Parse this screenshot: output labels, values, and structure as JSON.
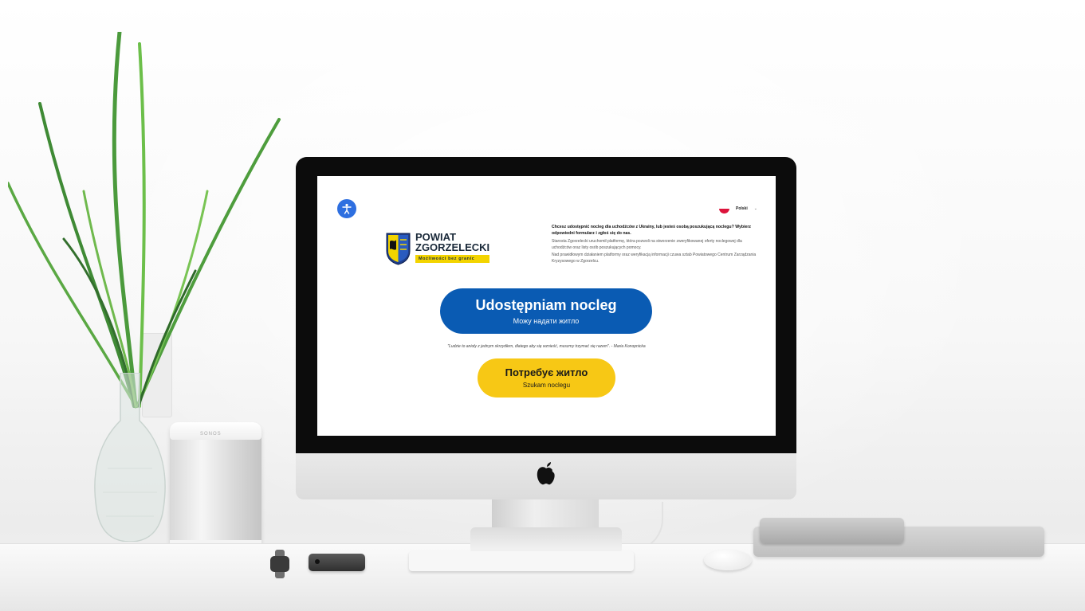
{
  "screen": {
    "accessibility": {
      "icon": "accessibility-person-icon",
      "color": "#2e6fe0"
    },
    "language": {
      "label": "Polski",
      "flag": "poland-flag-icon",
      "chevron": "chevron-down-icon"
    },
    "logo": {
      "line1": "POWIAT",
      "line2": "ZGORZELECKI",
      "tagline": "Możliwości bez granic",
      "crest": "coat-of-arms-crest-icon"
    },
    "intro": {
      "lead": "Chcesz udostępnić nocleg dla uchodźców z Ukrainy, lub jesteś osobą poszukującą noclegu? Wybierz odpowiedni formularz i zgłoś się do nas.",
      "p1": "Starosta Zgorzelecki uruchomił platformę, która pozwoli na stworzenie zweryfikowanej oferty noclegowej dla uchodźców oraz listy osób poszukujących pomocy.",
      "p2": "Nad prawidłowym działaniem platformy oraz weryfikacją informacji czuwa sztab Powiatowego Centrum Zarządzania Kryzysowego w Zgorzelcu."
    },
    "offer_button": {
      "title": "Udostępniam nocleg",
      "subtitle": "Можу надати житло",
      "color": "#0a5bb3"
    },
    "quote": "\"Ludzie to anioły z jednym skrzydłem, dlatego aby się wznieść, muszmy trzymać się razem\". - Maria Konopnicka",
    "need_button": {
      "title": "Потребує житло",
      "subtitle": "Szukam noclegu",
      "color": "#f7c815"
    }
  },
  "scene": {
    "speaker_brand": "SONOS"
  }
}
